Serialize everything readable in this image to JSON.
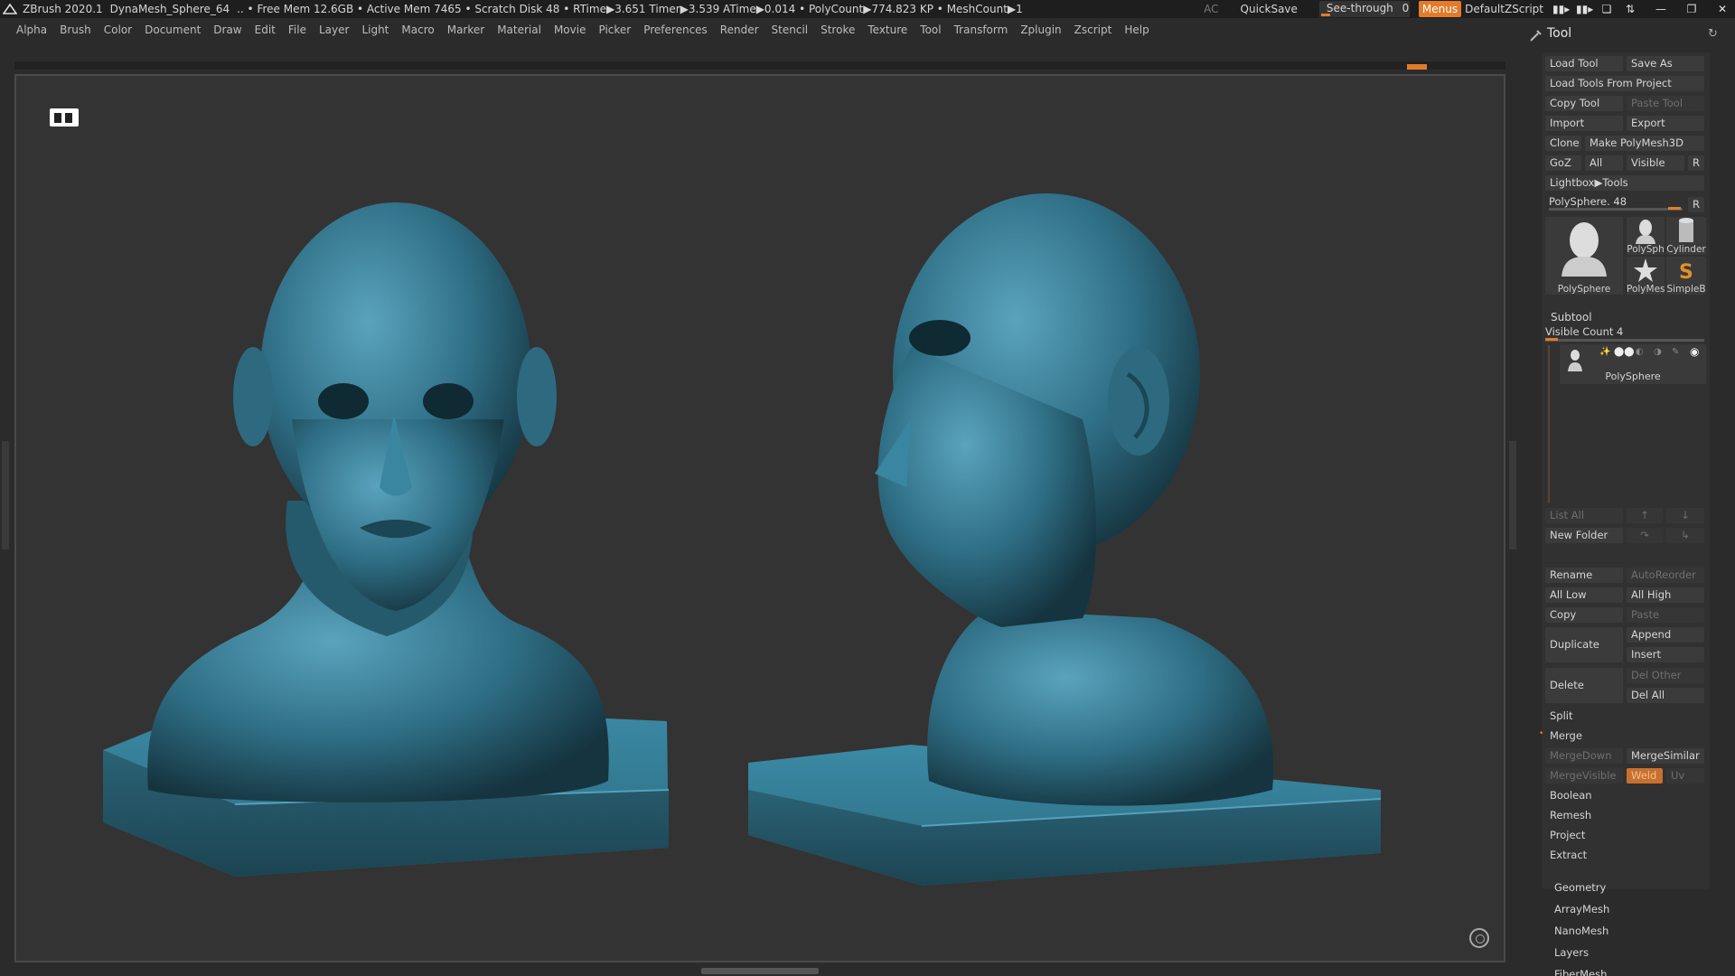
{
  "titlebar": {
    "app": "ZBrush 2020.1",
    "file": "DynaMesh_Sphere_64",
    "stats": ".. • Free Mem 12.6GB • Active Mem 7465 • Scratch Disk 48 •  RTime▶3.651 Timer▶3.539 ATime▶0.014 • PolyCount▶774.823 KP  • MeshCount▶1",
    "ac": "AC",
    "quicksave": "QuickSave",
    "seethrough_label": "See-through",
    "seethrough_value": "0",
    "menus": "Menus",
    "script": "DefaultZScript"
  },
  "menubar": [
    "Alpha",
    "Brush",
    "Color",
    "Document",
    "Draw",
    "Edit",
    "File",
    "Layer",
    "Light",
    "Macro",
    "Marker",
    "Material",
    "Movie",
    "Picker",
    "Preferences",
    "Render",
    "Stencil",
    "Stroke",
    "Texture",
    "Tool",
    "Transform",
    "Zplugin",
    "Zscript",
    "Help"
  ],
  "panel": {
    "title": "Tool",
    "load_tool": "Load Tool",
    "save_as": "Save As",
    "load_from_project": "Load Tools From Project",
    "copy_tool": "Copy Tool",
    "paste_tool": "Paste Tool",
    "import": "Import",
    "export": "Export",
    "clone": "Clone",
    "make_polymesh": "Make PolyMesh3D",
    "goz": "GoZ",
    "all": "All",
    "visible": "Visible",
    "r": "R",
    "lightbox_tools": "Lightbox▶Tools",
    "polysphere_slider": "PolySphere. 48",
    "thumbs": {
      "main": "PolySphere",
      "t1": "PolySph",
      "t2": "Cylinder",
      "t3": "PolyMes",
      "t4": "SimpleB"
    },
    "subtool": {
      "title": "Subtool",
      "visible_count": "Visible Count 4",
      "item": "PolySphere",
      "list_all": "List All",
      "new_folder": "New Folder",
      "rename": "Rename",
      "autoreorder": "AutoReorder",
      "all_low": "All Low",
      "all_high": "All High",
      "copy": "Copy",
      "paste": "Paste",
      "duplicate": "Duplicate",
      "append": "Append",
      "insert": "Insert",
      "delete": "Delete",
      "del_other": "Del Other",
      "del_all": "Del All",
      "split": "Split",
      "merge": "Merge",
      "mergedown": "MergeDown",
      "mergesimilar": "MergeSimilar",
      "mergevisible": "MergeVisible",
      "weld": "Weld",
      "uv": "Uv",
      "boolean": "Boolean",
      "remesh": "Remesh",
      "project": "Project",
      "extract": "Extract"
    },
    "sections": [
      "Geometry",
      "ArrayMesh",
      "NanoMesh",
      "Layers",
      "FiberMesh"
    ]
  },
  "colors": {
    "accent": "#e27b2a",
    "model": "#2f6f86",
    "background": "#333333"
  }
}
